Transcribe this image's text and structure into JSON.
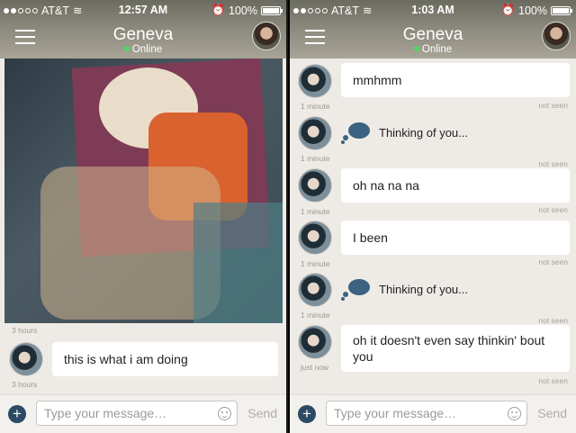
{
  "left": {
    "status": {
      "carrier": "AT&T",
      "time": "12:57 AM",
      "battery": "100%"
    },
    "header": {
      "title": "Geneva",
      "subtitle": "Online"
    },
    "photo_time": "3 hours",
    "messages": [
      {
        "text": "this is what i am doing",
        "time": "3 hours"
      }
    ],
    "composer": {
      "placeholder": "Type your message…",
      "send": "Send"
    }
  },
  "right": {
    "status": {
      "carrier": "AT&T",
      "time": "1:03 AM",
      "battery": "100%"
    },
    "header": {
      "title": "Geneva",
      "subtitle": "Online"
    },
    "messages": [
      {
        "text": "mmhmm",
        "time": "1 minute",
        "status": "not seen"
      },
      {
        "text": "Thinking of you...",
        "time": "1 minute",
        "status": "not seen",
        "type": "thinking"
      },
      {
        "text": "oh na na na",
        "time": "1 minute",
        "status": "not seen"
      },
      {
        "text": "I been",
        "time": "1 minute",
        "status": "not seen"
      },
      {
        "text": "Thinking of you...",
        "time": "1 minute",
        "status": "not seen",
        "type": "thinking"
      },
      {
        "text": "oh it doesn't even say thinkin' bout you",
        "time": "just now",
        "status": "not seen"
      }
    ],
    "composer": {
      "placeholder": "Type your message…",
      "send": "Send"
    }
  },
  "colors": {
    "accent_online": "#4cd964",
    "add_button": "#2c4a64",
    "thought_cloud": "#3b6280"
  }
}
